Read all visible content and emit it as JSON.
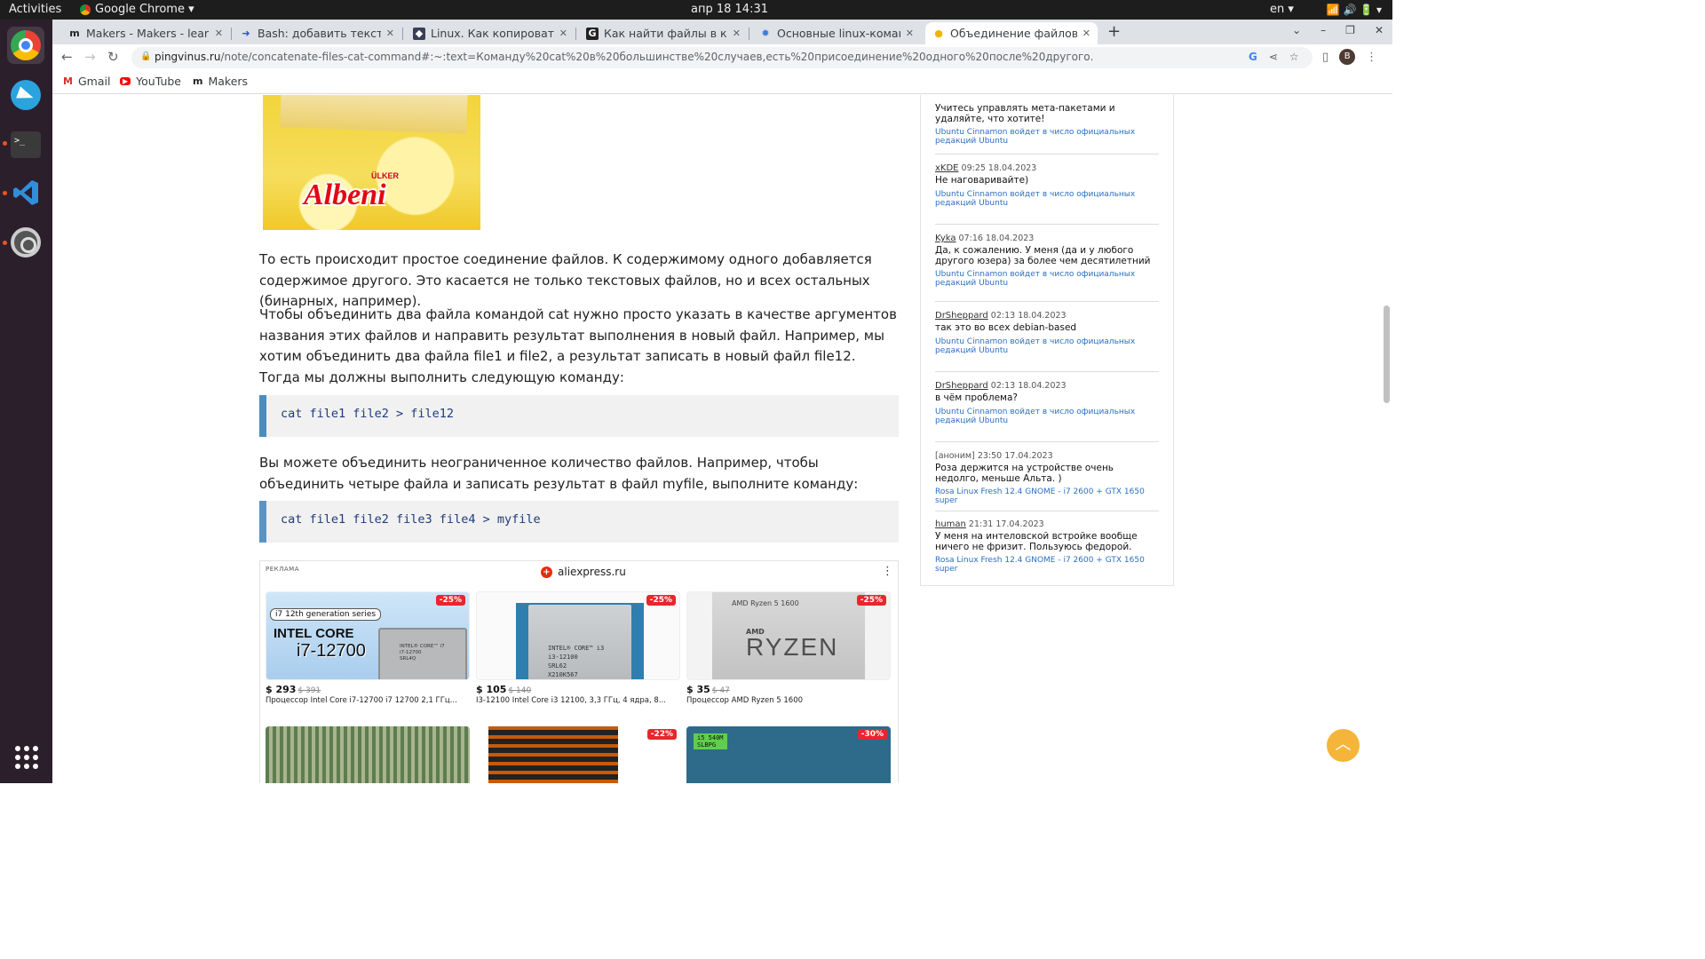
{
  "gnome": {
    "activities": "Activities",
    "app_menu": "Google Chrome ▾",
    "clock": "апр 18  14:31",
    "lang": "en ▾",
    "tray": "📶  🔊  🔋 ▾"
  },
  "tabs": [
    {
      "title": "Makers - Makers - learn ev",
      "favicon": "makers-icon",
      "active": false
    },
    {
      "title": "Bash: добавить текст в ф",
      "favicon": "arrow-icon",
      "active": false
    },
    {
      "title": "Linux. Как копировать сс",
      "favicon": "site-icon",
      "active": false
    },
    {
      "title": "Как найти файлы в коман",
      "favicon": "g-icon",
      "active": false
    },
    {
      "title": "Основные linux-команды",
      "favicon": "gear-site-icon",
      "active": false
    },
    {
      "title": "Объединение файлов кс",
      "favicon": "bulb-icon",
      "active": true
    }
  ],
  "toolbar": {
    "url_host": "pingvinus.ru",
    "url_path": "/note/concatenate-files-cat-command#:~:text=Команду%20cat%20в%20большинстве%20случаев,есть%20присоединение%20одного%20после%20другого.",
    "profile_initial": "B"
  },
  "bookmarks": [
    {
      "label": "Gmail",
      "icon": "gmail-icon"
    },
    {
      "label": "YouTube",
      "icon": "youtube-icon"
    },
    {
      "label": "Makers",
      "icon": "makers-icon"
    }
  ],
  "article": {
    "banner_brand_small": "ÜLKER",
    "banner_brand": "Albeni",
    "p1": "То есть происходит простое соединение файлов. К содержимому одного добавляется содержимое другого. Это касается не только текстовых файлов, но и всех остальных (бинарных, например).",
    "p2": "Чтобы объединить два файла командой cat нужно просто указать в качестве аргументов названия этих файлов и направить результат выполнения в новый файл. Например, мы хотим объединить два файла file1 и file2, а результат записать в новый файл file12. Тогда мы должны выполнить следующую команду:",
    "code1": "cat file1 file2 > file12",
    "p3": "Вы можете объединить неограниченное количество файлов. Например, чтобы объединить четыре файла и записать результат в файл myfile, выполните команду:",
    "code2": "cat file1 file2 file3 file4 > myfile"
  },
  "ad": {
    "label": "РЕКЛАМА",
    "source": "aliexpress.ru",
    "products": [
      {
        "discount": "-25%",
        "price": "$ 293",
        "old_price": "$ 391",
        "name": "Процессор Intel Core i7-12700 i7 12700 2,1 ГГц...",
        "img_gen": "i7 12th generation series",
        "img_core": "INTEL CORE",
        "img_model": "i7-12700",
        "img_chip": "INTEL® CORE™ i7\ni7-12700\nSRL4Q"
      },
      {
        "discount": "-25%",
        "price": "$ 105",
        "old_price": "$ 140",
        "name": "I3-12100 Intel Core i3 12100, 3,3 ГГц, 4 ядра, 8...",
        "img_chip": "INTEL® CORE™ i3\ni3-12100\nSRL62\nX210K567"
      },
      {
        "discount": "-25%",
        "price": "$ 35",
        "old_price": "$ 47",
        "name": "Процессор AMD Ryzen 5 1600",
        "img_label": "AMD Ryzen 5 1600",
        "img_amd": "AMD",
        "img_ryzen": "RYZEN"
      }
    ],
    "row2_discounts": [
      "-22%",
      "-30%"
    ],
    "row2_chip_label": "i5 540M\nSLBPG"
  },
  "comments": [
    {
      "author": "",
      "time": "",
      "text": "Учитесь управлять мета-пакетами и удаляйте, что хотите!",
      "link": "Ubuntu Cinnamon войдет в число официальных редакций Ubuntu"
    },
    {
      "author": "xKDE",
      "time": "09:25 18.04.2023",
      "text": "Не наговаривайте)",
      "link": "Ubuntu Cinnamon войдет в число официальных редакций Ubuntu"
    },
    {
      "author": "Kyka",
      "time": "07:16 18.04.2023",
      "text": "Да, к сожалению. У меня (да и у любого другого юзера) за более чем десятилетний период...",
      "link": "Ubuntu Cinnamon войдет в число официальных редакций Ubuntu"
    },
    {
      "author": "DrSheppard",
      "time": "02:13 18.04.2023",
      "text": "так это во всех debian-based",
      "link": "Ubuntu Cinnamon войдет в число официальных редакций Ubuntu"
    },
    {
      "author": "DrSheppard",
      "time": "02:13 18.04.2023",
      "text": "в чём проблема?",
      "link": "Ubuntu Cinnamon войдет в число официальных редакций Ubuntu"
    },
    {
      "author": "[аноним]",
      "time": "23:50 17.04.2023",
      "text": "Роза держится на устройстве очень недолго, меньше Альта. )",
      "link": "Rosa Linux Fresh 12.4 GNOME - i7 2600 + GTX 1650 super"
    },
    {
      "author": "human",
      "time": "21:31 17.04.2023",
      "text": "У меня на интеловской встройке вообще ничего не фризит. Пользуюсь федорой.",
      "link": "Rosa Linux Fresh 12.4 GNOME - i7 2600 + GTX 1650 super"
    }
  ],
  "colors": {
    "code_border": "#4a8dbe",
    "link": "#2b6fc1",
    "to_top": "#f5b53b",
    "discount": "#e8262c"
  }
}
